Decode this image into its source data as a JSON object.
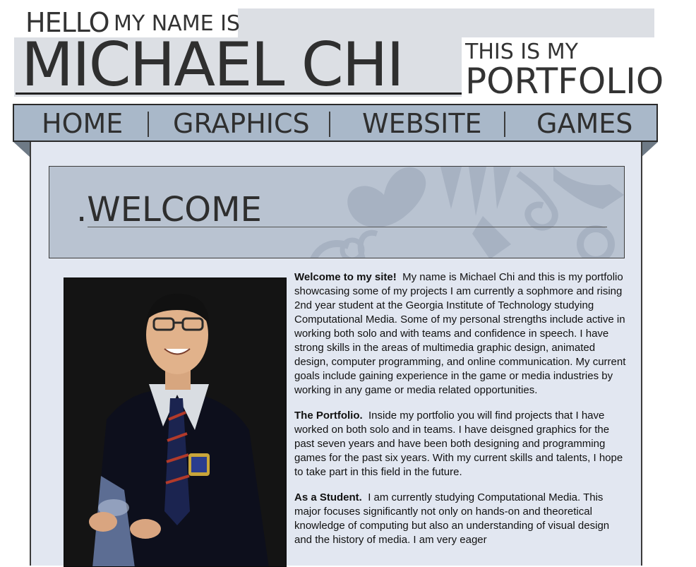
{
  "header": {
    "hello": "HELLO",
    "my_name_is": "MY NAME IS",
    "name": "MICHAEL CHI",
    "this_is_my": "THIS IS MY",
    "portfolio": "PORTFOLIO"
  },
  "nav": {
    "items": [
      {
        "label": "HOME"
      },
      {
        "label": "GRAPHICS"
      },
      {
        "label": "WEBSITE"
      },
      {
        "label": "GAMES"
      }
    ]
  },
  "welcome": {
    "title": ".WELCOME"
  },
  "content": {
    "paragraphs": [
      {
        "lead": "Welcome to my site!",
        "body": "My name is Michael Chi and this is my portfolio showcasing some of my projects I am currently a sophmore and rising 2nd year student at the Georgia Institute of Technology studying Computational Media. Some of my personal strengths include active in working both solo and with teams and confidence in speech. I have strong skills in the areas of multimedia graphic design, animated design, computer programming, and online communication. My current goals include gaining experience in the game or media industries by working in any game or media related opportunities."
      },
      {
        "lead": "The Portfolio.",
        "body": "Inside my portfolio you will find projects that I have worked on both solo and in teams. I have deisgned graphics for the past seven years and have been both designing and programming games for the past six years. With my current skills and talents, I hope to take part in this field in the future."
      },
      {
        "lead": "As a Student.",
        "body": "I am currently studying Computational Media. This major focuses significantly not only on hands-on and theoretical knowledge of computing but also an understanding of visual design and the history of media. I am very eager"
      }
    ]
  },
  "colors": {
    "nav_bg": "#a9b8c9",
    "panel_bg": "#e2e7f1",
    "welcome_bg": "#b9c3d1",
    "header_band": "#dcdfe4"
  }
}
